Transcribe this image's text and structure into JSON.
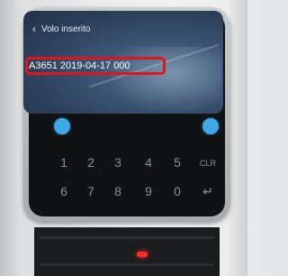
{
  "header": {
    "back_icon": "chevron-left-icon",
    "title": "Volo inserito"
  },
  "flight_entry": {
    "text": "A3651 2019-04-17 000",
    "highlight_color": "#e3141c"
  },
  "screen_buttons": {
    "color": "#3fa9e6"
  },
  "keypad": {
    "row1": [
      "1",
      "2",
      "3",
      "4",
      "5",
      "CLR"
    ],
    "row2": [
      "6",
      "7",
      "8",
      "9",
      "0",
      "↵"
    ]
  },
  "indicator": {
    "color": "#ff2a2a"
  }
}
